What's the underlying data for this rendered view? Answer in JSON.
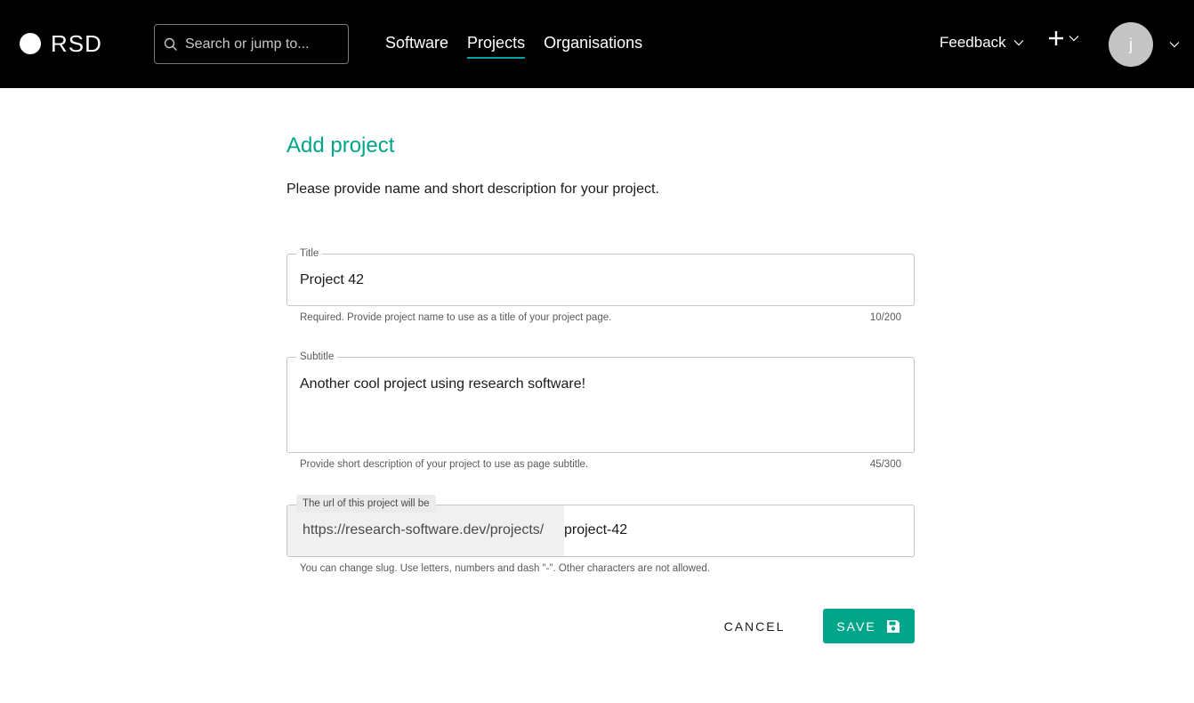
{
  "header": {
    "logo_text": "RSD",
    "search_placeholder": "Search or jump to...",
    "nav": [
      {
        "label": "Software",
        "active": false
      },
      {
        "label": "Projects",
        "active": true
      },
      {
        "label": "Organisations",
        "active": false
      }
    ],
    "feedback_label": "Feedback",
    "add_icon": "plus-icon",
    "avatar_initial": "j"
  },
  "page": {
    "title": "Add project",
    "description": "Please provide name and short description for your project."
  },
  "form": {
    "title_field": {
      "label": "Title",
      "value": "Project 42",
      "helper": "Required. Provide project name to use as a title of your project page.",
      "counter": "10/200"
    },
    "subtitle_field": {
      "label": "Subtitle",
      "value": "Another cool project using research software!",
      "helper": "Provide short description of your project to use as page subtitle.",
      "counter": "45/300"
    },
    "slug_field": {
      "label": "The url of this project will be",
      "prefix": "https://research-software.dev/projects/",
      "value": "project-42",
      "helper": "You can change slug. Use letters, numbers and dash \"-\". Other characters are not allowed."
    }
  },
  "actions": {
    "cancel_label": "CANCEL",
    "save_label": "SAVE",
    "save_icon": "floppy-disk-icon"
  },
  "colors": {
    "header_bg": "#000000",
    "accent": "#00a58a",
    "nav_underline": "#00a3a3"
  }
}
